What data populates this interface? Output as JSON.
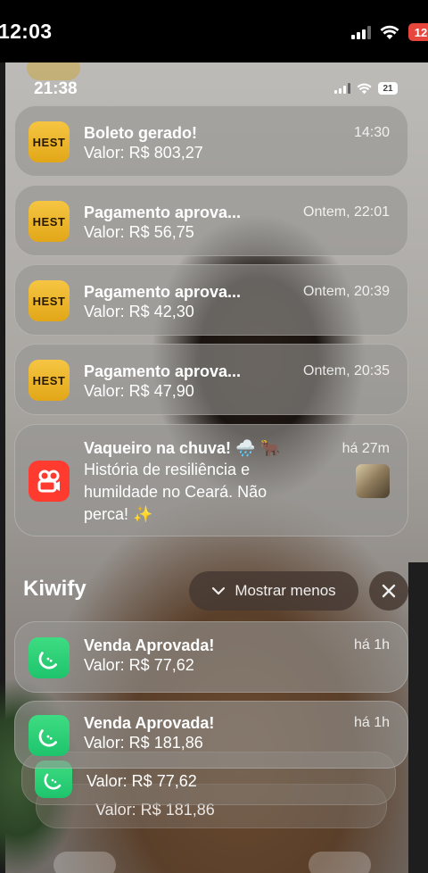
{
  "outer_status": {
    "time": "12:03",
    "battery": "12"
  },
  "inner_status": {
    "time": "21:38",
    "battery": "21"
  },
  "notifications": [
    {
      "app": "HEST",
      "title": "Boleto gerado!",
      "body": "Valor: R$ 803,27",
      "time": "14:30"
    },
    {
      "app": "HEST",
      "title": "Pagamento aprova...",
      "body": "Valor: R$ 56,75",
      "time": "Ontem, 22:01"
    },
    {
      "app": "HEST",
      "title": "Pagamento aprova...",
      "body": "Valor: R$ 42,30",
      "time": "Ontem, 20:39"
    },
    {
      "app": "HEST",
      "title": "Pagamento aprova...",
      "body": "Valor: R$ 47,90",
      "time": "Ontem, 20:35"
    }
  ],
  "kwai_notification": {
    "title": "Vaqueiro na chuva! 🌧️ 🐂",
    "body_line1": "História de resiliência e",
    "body_line2": "humildade no Ceará. Não",
    "body_line3": "perca! ✨",
    "time": "há 27m"
  },
  "kiwify_group": {
    "title": "Kiwify",
    "show_less_label": "Mostrar menos",
    "items": [
      {
        "title": "Venda Aprovada!",
        "body": "Valor: R$ 77,62",
        "time": "há 1h"
      },
      {
        "title": "Venda Aprovada!",
        "body": "Valor: R$ 181,86",
        "time": "há 1h"
      }
    ],
    "ghost_bodies": [
      "Valor: R$ 77,62",
      "Valor: R$ 181,86"
    ]
  },
  "colors": {
    "hest_icon": "#f2bd35",
    "kiwify_icon": "#2ad178",
    "kwai_icon": "#ff3b30"
  }
}
